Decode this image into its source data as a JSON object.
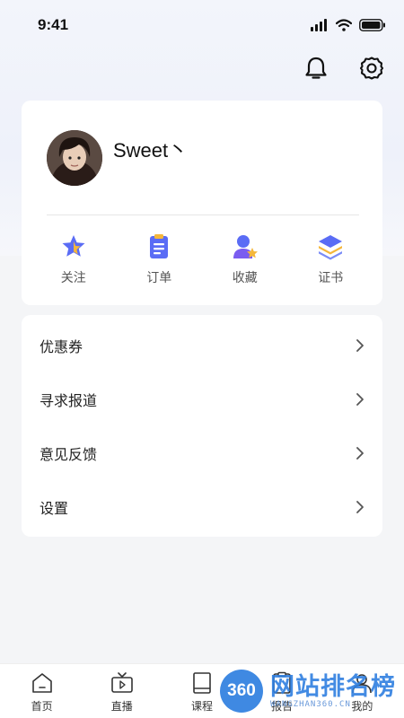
{
  "status_bar": {
    "time": "9:41"
  },
  "header": {
    "bell_icon": "bell-icon",
    "settings_icon": "gear-icon"
  },
  "profile": {
    "name": "Sweet丶"
  },
  "quick_links": [
    {
      "label": "关注",
      "icon": "star-icon"
    },
    {
      "label": "订单",
      "icon": "clipboard-icon"
    },
    {
      "label": "收藏",
      "icon": "user-star-icon"
    },
    {
      "label": "证书",
      "icon": "layers-icon"
    }
  ],
  "menu": [
    {
      "label": "优惠券"
    },
    {
      "label": "寻求报道"
    },
    {
      "label": "意见反馈"
    },
    {
      "label": "设置"
    }
  ],
  "tabs": [
    {
      "label": "首页",
      "icon": "home-icon"
    },
    {
      "label": "直播",
      "icon": "tv-icon"
    },
    {
      "label": "课程",
      "icon": "book-icon"
    },
    {
      "label": "报告",
      "icon": "report-icon"
    },
    {
      "label": "我的",
      "icon": "user-icon",
      "active": true
    }
  ],
  "watermark": {
    "logo": "360",
    "title": "网站排名榜",
    "subtitle": "WANGZHAN360.CN"
  },
  "colors": {
    "accent": "#4f6bff",
    "watermark_blue": "#2f7fe0"
  }
}
